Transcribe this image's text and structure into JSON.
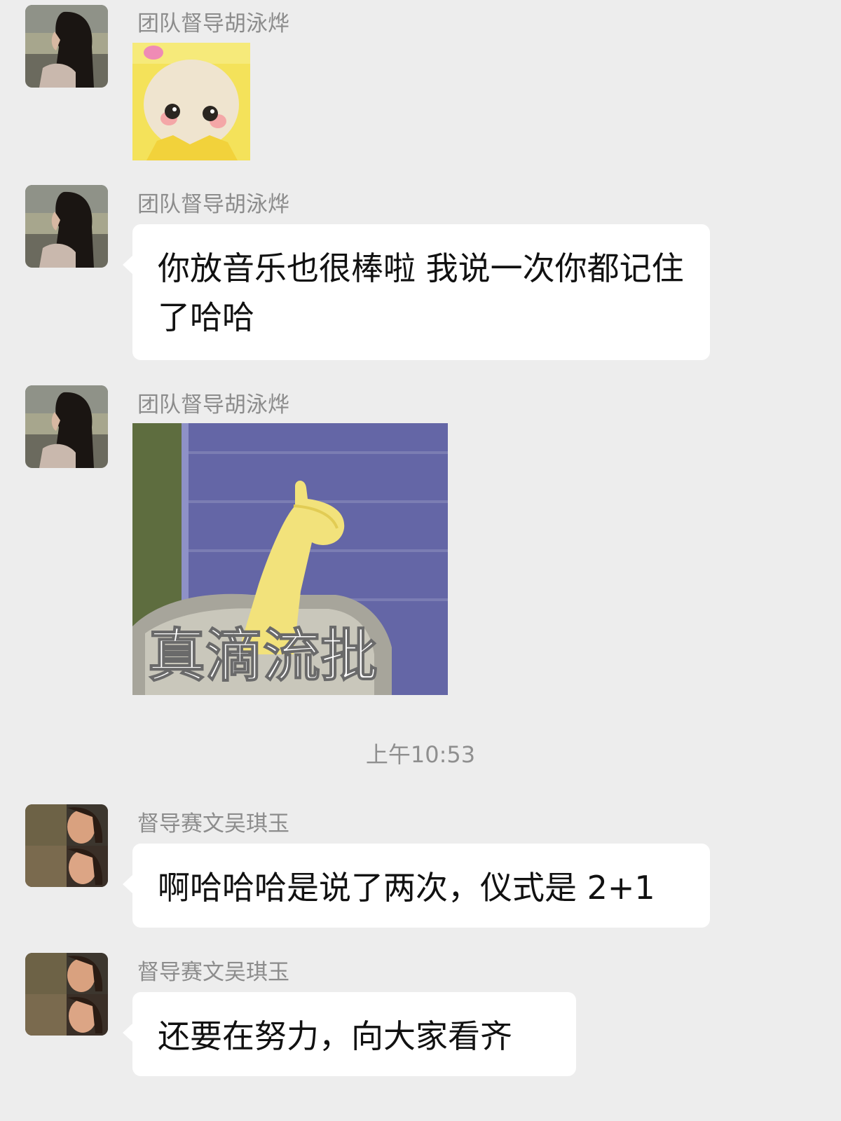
{
  "messages": [
    {
      "sender": "团队督导胡泳烨",
      "type": "sticker",
      "sticker_icon": "yellow-teletubby-sticker"
    },
    {
      "sender": "团队督导胡泳烨",
      "type": "text",
      "text": "你放音乐也很棒啦 我说一次你都记住了哈哈"
    },
    {
      "sender": "团队督导胡泳烨",
      "type": "sticker",
      "sticker_icon": "thumbs-up-sticker",
      "sticker_text": "真滴流批"
    },
    {
      "sender": "督导赛文吴琪玉",
      "type": "text",
      "text": "啊哈哈哈是说了两次，仪式是 2+1"
    },
    {
      "sender": "督导赛文吴琪玉",
      "type": "text",
      "text": "还要在努力，向大家看齐"
    }
  ],
  "timestamp": "上午10:53",
  "colors": {
    "background": "#ededed",
    "bubble": "#ffffff",
    "sender_name": "#8c8c8c"
  }
}
